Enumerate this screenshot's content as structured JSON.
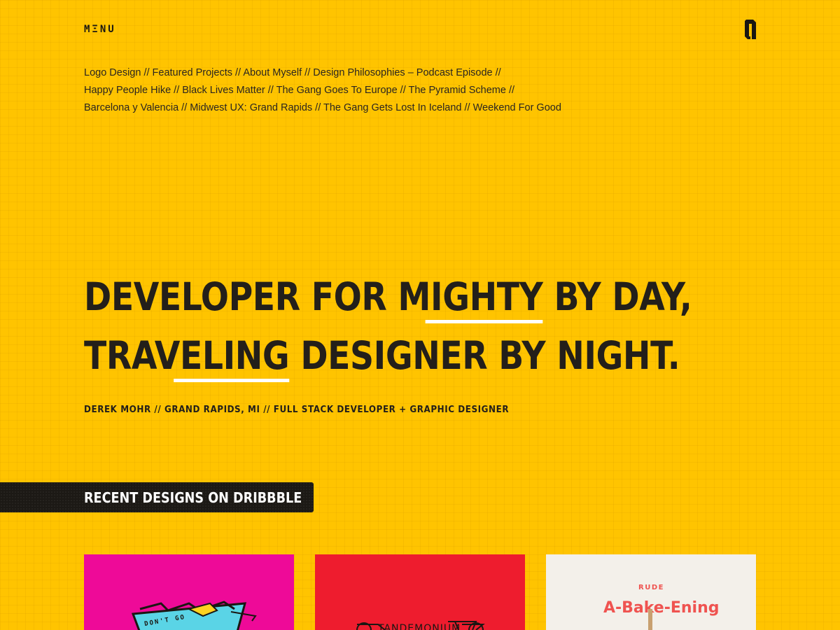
{
  "header": {
    "menu_label": "MΞNU",
    "logo_icon": "logo-icon"
  },
  "nav": {
    "lines": [
      [
        "Logo Design",
        "Featured Projects",
        "About Myself",
        "Design Philosophies – Podcast Episode"
      ],
      [
        "Happy People Hike",
        "Black Lives Matter",
        "The Gang Goes To Europe",
        "The Pyramid Scheme"
      ],
      [
        "Barcelona y Valencia",
        "Midwest UX: Grand Rapids",
        "The Gang Gets Lost In Iceland",
        "Weekend For Good"
      ]
    ],
    "separator": " // ",
    "trailing": " //"
  },
  "hero": {
    "line1_before": "DEVELOPER FOR ",
    "line1_highlight": "MIGHTY",
    "line1_after": " BY DAY,",
    "line2_before": "TR",
    "line2_highlight": "AVELING",
    "line2_after": " DESIGNER BY NIGHT."
  },
  "byline": "DEREK MOHR // GRAND RAPIDS, MI // FULL STACK DEVELOPER + GRAPHIC DESIGNER",
  "dribbble": {
    "title": "RECENT DESIGNS ON DRIBBBLE",
    "shots": [
      {
        "bg": "#ee0a98",
        "text": "DON'T GO"
      },
      {
        "bg": "#ee1c2e",
        "text": "TANDEMONIUM"
      },
      {
        "bg": "#f3f0ea",
        "label_top": "RUDE",
        "label_main": "A-Bake-Ening"
      }
    ]
  },
  "colors": {
    "background": "#FFC400",
    "text": "#231f1a",
    "highlight": "#ffffff",
    "banner": "#1c1915"
  }
}
